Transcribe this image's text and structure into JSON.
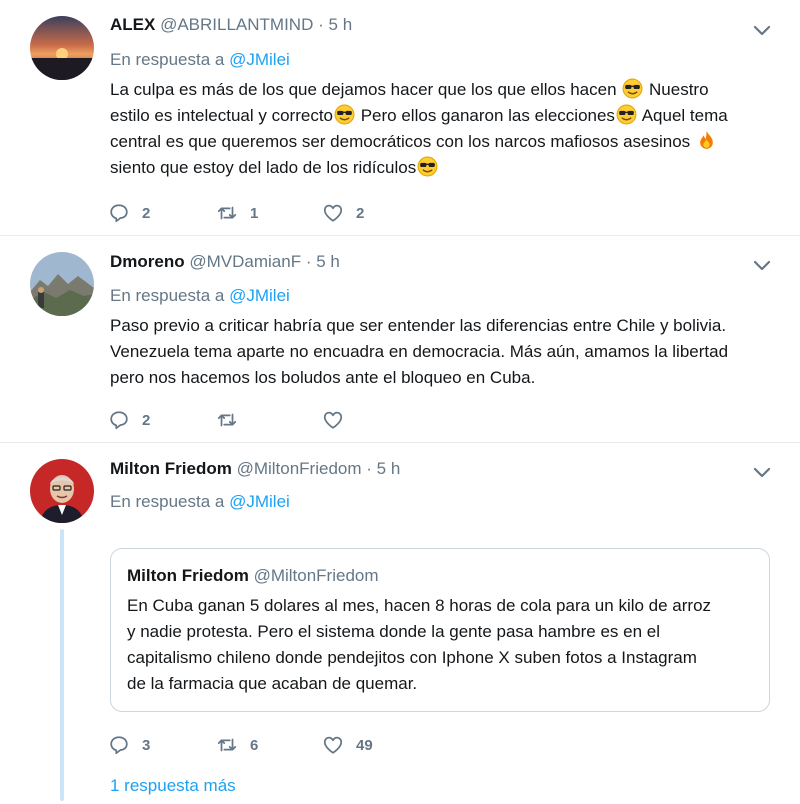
{
  "tweets": [
    {
      "name": "ALEX",
      "handle": "@ABRILLANTMIND",
      "separator": "·",
      "time": "5 h",
      "reply_prefix": "En respuesta a",
      "reply_mention": "@JMilei",
      "lines": [
        [
          "La culpa es más de los que dejamos hacer que los que ellos hacen ",
          "😎",
          " Nuestro"
        ],
        [
          "estilo es intelectual y  correcto",
          "😎",
          " Pero ellos ganaron las elecciones",
          "😎",
          " Aquel tema"
        ],
        [
          "central es que queremos ser democráticos con los narcos mafiosos asesinos ",
          "🔥"
        ],
        [
          "siento que estoy del lado de los ridículos",
          "😎"
        ]
      ],
      "replies": "2",
      "retweets": "1",
      "likes": "2",
      "avatar_icon": "sunset-avatar"
    },
    {
      "name": "Dmoreno",
      "handle": "@MVDamianF",
      "separator": "·",
      "time": "5 h",
      "reply_prefix": "En respuesta a",
      "reply_mention": "@JMilei",
      "lines": [
        "Paso previo a criticar habría que ser entender las diferencias entre Chile y bolivia.",
        "Venezuela tema aparte no encuadra en democracia. Más aún, amamos la libertad",
        "pero nos hacemos los boludos ante el bloqueo en Cuba."
      ],
      "replies": "2",
      "retweets": "",
      "likes": "",
      "avatar_icon": "landscape-avatar"
    },
    {
      "name": "Milton Friedom",
      "handle": "@MiltonFriedom",
      "separator": "·",
      "time": "5 h",
      "reply_prefix": "En respuesta a",
      "reply_mention": "@JMilei",
      "replies": "3",
      "retweets": "6",
      "likes": "49",
      "avatar_icon": "portrait-avatar",
      "quote": {
        "name": "Milton Friedom",
        "handle": "@MiltonFriedom",
        "lines": [
          "En Cuba ganan 5 dolares al mes, hacen 8 horas de cola para un kilo de arroz",
          "y nadie protesta. Pero el sistema donde la gente pasa hambre es en el",
          "capitalismo chileno donde pendejitos con Iphone X suben fotos a Instagram",
          "de la farmacia que acaban de quemar."
        ]
      }
    }
  ],
  "more_replies": "1 respuesta más",
  "colors": {
    "link": "#1da1f2",
    "secondary_text": "#657786",
    "divider": "#e6ecf0",
    "thread_line": "#cce4f7"
  }
}
